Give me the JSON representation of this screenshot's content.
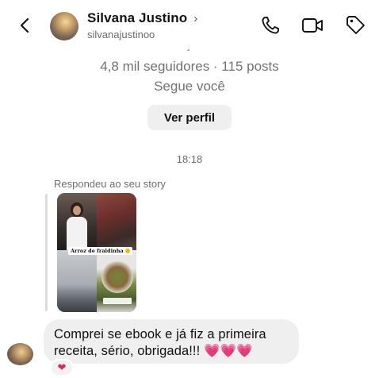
{
  "header": {
    "name": "Silvana Justino",
    "chevron": "›",
    "username": "silvanajustinoo",
    "icons": [
      "back-arrow-icon",
      "phone-icon",
      "video-camera-icon",
      "tag-icon"
    ]
  },
  "profile": {
    "username": "silvanajustinoo",
    "stats": "4,8 mil seguidores · 115 posts",
    "follows_you": "Segue você",
    "view_profile_label": "Ver perfil"
  },
  "thread": {
    "timestamp": "18:18",
    "story_reply_caption": "Respondeu ao seu story",
    "story_label": "Arroz de fraldinha",
    "message_text": "Comprei se ebook e já fiz a primeira receita, sério, obrigada!!!",
    "message_emoji": "💗💗💗",
    "reaction_emoji": "❤"
  },
  "colors": {
    "heart": "#ff2d8a",
    "reaction": "#e0245e",
    "bubble": "#efefef",
    "button": "#efefef"
  }
}
